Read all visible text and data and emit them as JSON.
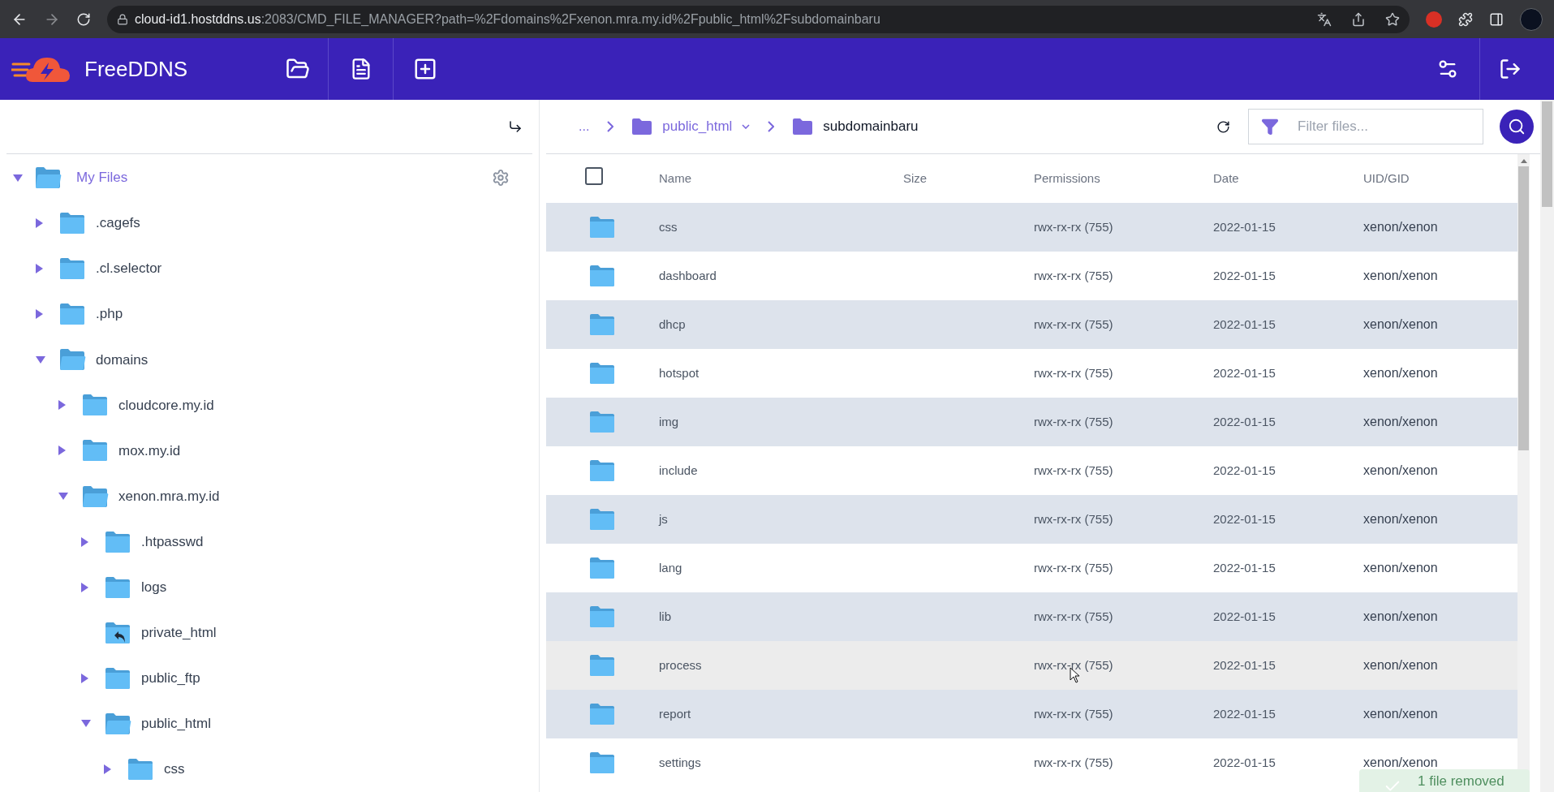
{
  "browser": {
    "host": "cloud-id1.hostddns.us",
    "path": ":2083/CMD_FILE_MANAGER?path=%2Fdomains%2Fxenon.mra.my.id%2Fpublic_html%2Fsubdomainbaru"
  },
  "header": {
    "brand": "FreeDDNS"
  },
  "tree": {
    "label": "My Files",
    "expanded": true,
    "children": [
      {
        "label": ".cagefs",
        "kind": "folder",
        "expanded": false
      },
      {
        "label": ".cl.selector",
        "kind": "folder",
        "expanded": false
      },
      {
        "label": ".php",
        "kind": "folder",
        "expanded": false
      },
      {
        "label": "domains",
        "kind": "folder",
        "expanded": true,
        "children": [
          {
            "label": "cloudcore.my.id",
            "kind": "folder",
            "expanded": false
          },
          {
            "label": "mox.my.id",
            "kind": "folder",
            "expanded": false
          },
          {
            "label": "xenon.mra.my.id",
            "kind": "folder",
            "expanded": true,
            "children": [
              {
                "label": ".htpasswd",
                "kind": "folder",
                "expanded": false
              },
              {
                "label": "logs",
                "kind": "folder",
                "expanded": false
              },
              {
                "label": "private_html",
                "kind": "link"
              },
              {
                "label": "public_ftp",
                "kind": "folder",
                "expanded": false
              },
              {
                "label": "public_html",
                "kind": "folder",
                "expanded": true,
                "children": [
                  {
                    "label": "css",
                    "kind": "folder",
                    "expanded": false
                  }
                ]
              }
            ]
          }
        ]
      }
    ]
  },
  "breadcrumb": [
    {
      "label": "...",
      "kind": "ellipsis"
    },
    {
      "label": "public_html",
      "kind": "dropdown"
    },
    {
      "label": "subdomainbaru",
      "kind": "current"
    }
  ],
  "filter": {
    "placeholder": "Filter files..."
  },
  "table": {
    "select_all": {
      "checked": false
    },
    "columns": [
      "Name",
      "Size",
      "Permissions",
      "Date",
      "UID/GID"
    ],
    "rows": [
      {
        "name": "css",
        "permissions": "rwx-rx-rx (755)",
        "date": "2022-01-15",
        "owner": "xenon/xenon",
        "hovered": false
      },
      {
        "name": "dashboard",
        "permissions": "rwx-rx-rx (755)",
        "date": "2022-01-15",
        "owner": "xenon/xenon",
        "hovered": false
      },
      {
        "name": "dhcp",
        "permissions": "rwx-rx-rx (755)",
        "date": "2022-01-15",
        "owner": "xenon/xenon",
        "hovered": false
      },
      {
        "name": "hotspot",
        "permissions": "rwx-rx-rx (755)",
        "date": "2022-01-15",
        "owner": "xenon/xenon",
        "hovered": false
      },
      {
        "name": "img",
        "permissions": "rwx-rx-rx (755)",
        "date": "2022-01-15",
        "owner": "xenon/xenon",
        "hovered": false
      },
      {
        "name": "include",
        "permissions": "rwx-rx-rx (755)",
        "date": "2022-01-15",
        "owner": "xenon/xenon",
        "hovered": false
      },
      {
        "name": "js",
        "permissions": "rwx-rx-rx (755)",
        "date": "2022-01-15",
        "owner": "xenon/xenon",
        "hovered": false
      },
      {
        "name": "lang",
        "permissions": "rwx-rx-rx (755)",
        "date": "2022-01-15",
        "owner": "xenon/xenon",
        "hovered": false
      },
      {
        "name": "lib",
        "permissions": "rwx-rx-rx (755)",
        "date": "2022-01-15",
        "owner": "xenon/xenon",
        "hovered": false
      },
      {
        "name": "process",
        "permissions": "rwx-rx-rx (755)",
        "date": "2022-01-15",
        "owner": "xenon/xenon",
        "hovered": true
      },
      {
        "name": "report",
        "permissions": "rwx-rx-rx (755)",
        "date": "2022-01-15",
        "owner": "xenon/xenon",
        "hovered": false
      },
      {
        "name": "settings",
        "permissions": "rwx-rx-rx (755)",
        "date": "2022-01-15",
        "owner": "xenon/xenon",
        "hovered": false
      }
    ]
  },
  "toast": {
    "message": "1 file removed"
  }
}
